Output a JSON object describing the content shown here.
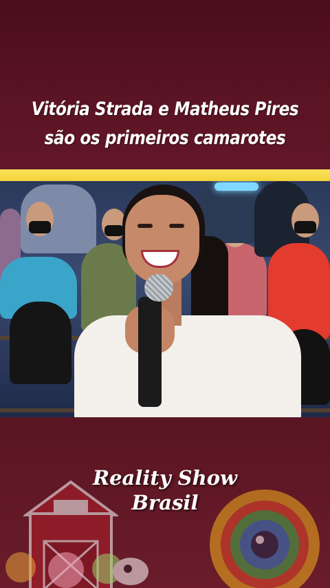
{
  "headline": {
    "line1": "Vitória Strada e Matheus Pires",
    "line2": "são os primeiros camarotes"
  },
  "brand": {
    "line1": "Reality Show",
    "line2": "Brasil"
  },
  "colors": {
    "background": "#5b1320",
    "accent_bar": "#f3d23a",
    "headline_text": "#ffffff"
  },
  "icons": {
    "barn": "barn-icon",
    "eye_logo": "big-brother-eye-icon",
    "farm_animals": "farm-animals-icon"
  }
}
